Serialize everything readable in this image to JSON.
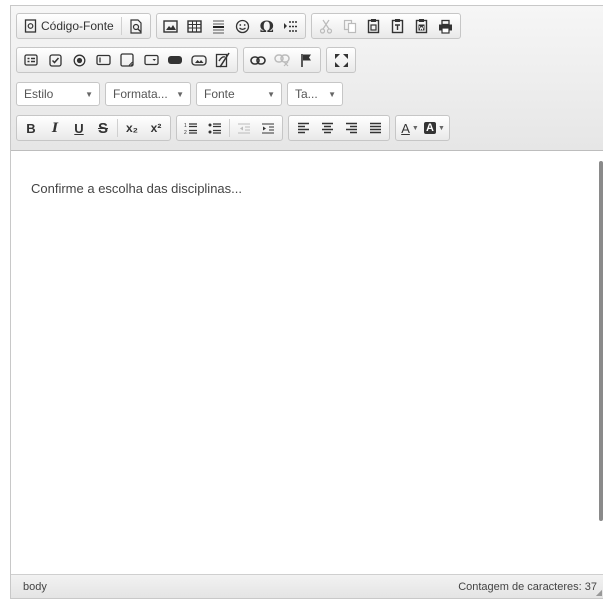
{
  "toolbar": {
    "source_label": "Código-Fonte",
    "styles_combo": "Estilo",
    "format_combo": "Formata...",
    "font_combo": "Fonte",
    "size_combo": "Ta...",
    "bold": "B",
    "italic": "I",
    "underline": "U",
    "strike": "S",
    "subscript": "x₂",
    "superscript": "x²",
    "text_color": "A",
    "bg_color": "A"
  },
  "content": {
    "text": "Confirme a escolha das disciplinas..."
  },
  "statusbar": {
    "path": "body",
    "char_count": "Contagem de caracteres: 37"
  }
}
